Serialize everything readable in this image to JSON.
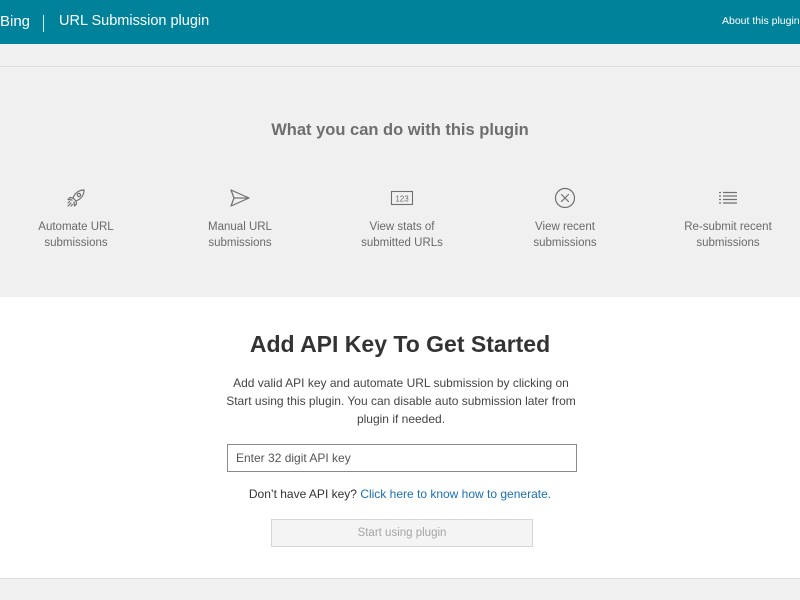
{
  "header": {
    "brand": "Bing",
    "title": "URL Submission plugin",
    "about_link": "About this plugin"
  },
  "features": {
    "heading": "What you can do with this plugin",
    "items": [
      {
        "icon": "rocket-icon",
        "label": "Automate URL\nsubmissions"
      },
      {
        "icon": "send-icon",
        "label": "Manual URL\nsubmissions"
      },
      {
        "icon": "counter-123-icon",
        "icon_text": "123",
        "label": "View stats of\nsubmitted URLs"
      },
      {
        "icon": "circle-x-icon",
        "label": "View recent\nsubmissions"
      },
      {
        "icon": "list-icon",
        "label": "Re-submit recent\nsubmissions"
      }
    ]
  },
  "main": {
    "heading": "Add API Key To Get Started",
    "description": "Add valid API key and automate URL submission by clicking on Start using this plugin. You can disable auto submission later from plugin if needed.",
    "api_key_input": {
      "value": "",
      "placeholder": "Enter 32 digit API key"
    },
    "help_prefix": "Don’t have API key?",
    "help_link": "Click here to know how to generate.",
    "start_button": "Start using plugin"
  },
  "colors": {
    "header_bg": "#00829b",
    "link": "#1a6fb5",
    "disabled_button_text": "#a5a5a5"
  }
}
